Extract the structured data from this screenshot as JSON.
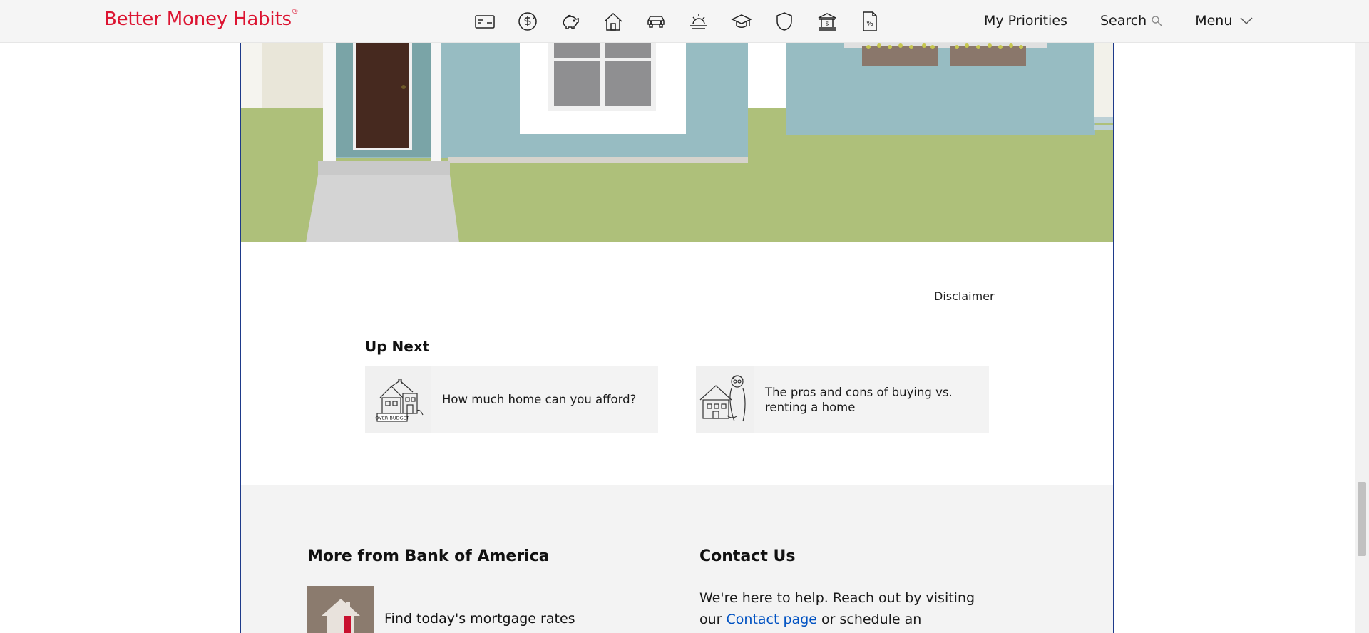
{
  "header": {
    "logo_text": "Better Money Habits",
    "logo_mark": "®",
    "brand_color": "#dc1431",
    "category_icons": [
      "credit-card-icon",
      "dollar-exchange-icon",
      "piggy-bank-icon",
      "home-icon",
      "car-icon",
      "sunset-retirement-icon",
      "graduation-cap-icon",
      "shield-icon",
      "bank-building-icon",
      "tax-document-icon"
    ],
    "nav": {
      "priorities": "My Priorities",
      "search": "Search",
      "menu": "Menu"
    }
  },
  "main": {
    "disclaimer": "Disclaimer",
    "up_next": {
      "title": "Up Next",
      "cards": [
        {
          "label": "How much home can you afford?",
          "thumb": "over-budget-house-icon",
          "thumb_caption": "OVER BUDGET"
        },
        {
          "label": "The pros and cons of buying vs. renting a home",
          "thumb": "person-holding-house-icon"
        }
      ]
    }
  },
  "footer": {
    "more_title": "More from Bank of America",
    "mortgage_link": "Find today's mortgage rates",
    "contact_title": "Contact Us",
    "contact_text_before": "We're here to help. Reach out by visiting our",
    "contact_link": "Contact page",
    "contact_text_after": "or schedule an appointment today."
  },
  "colors": {
    "accent_red": "#dc1431",
    "link_blue": "#0052c2",
    "house_wall": "#97bcc2",
    "lawn": "#aec07a",
    "door": "#46291f"
  }
}
